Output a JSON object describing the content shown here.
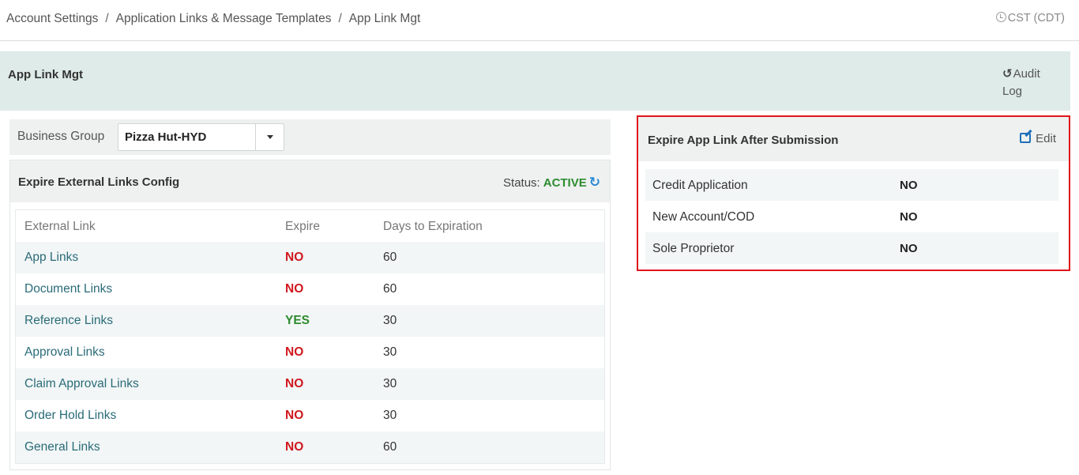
{
  "breadcrumb": {
    "items": [
      "Account Settings",
      "Application Links & Message Templates",
      "App Link Mgt"
    ],
    "separator": "/"
  },
  "timezone": "CST (CDT)",
  "page": {
    "title": "App Link Mgt",
    "audit_log_label": "Audit Log",
    "audit_icon": "history-icon"
  },
  "business_group": {
    "label": "Business Group",
    "selected": "Pizza Hut-HYD"
  },
  "external_links_config": {
    "title": "Expire External Links Config",
    "status_label": "Status:",
    "status_value": "ACTIVE",
    "columns": [
      "External Link",
      "Expire",
      "Days to Expiration"
    ],
    "rows": [
      {
        "link": "App Links",
        "expire": "NO",
        "days": "60"
      },
      {
        "link": "Document Links",
        "expire": "NO",
        "days": "60"
      },
      {
        "link": "Reference Links",
        "expire": "YES",
        "days": "30"
      },
      {
        "link": "Approval Links",
        "expire": "NO",
        "days": "30"
      },
      {
        "link": "Claim Approval Links",
        "expire": "NO",
        "days": "30"
      },
      {
        "link": "Order Hold Links",
        "expire": "NO",
        "days": "30"
      },
      {
        "link": "General Links",
        "expire": "NO",
        "days": "60"
      }
    ]
  },
  "expire_after_submission": {
    "title": "Expire App Link After Submission",
    "edit_label": "Edit",
    "rows": [
      {
        "label": "Credit Application",
        "value": "NO"
      },
      {
        "label": "New Account/COD",
        "value": "NO"
      },
      {
        "label": "Sole Proprietor",
        "value": "NO"
      }
    ]
  },
  "colors": {
    "no": "#d0171e",
    "yes": "#2e8b2e",
    "highlight_border": "#e0141b",
    "header_bg": "#deebe8"
  }
}
